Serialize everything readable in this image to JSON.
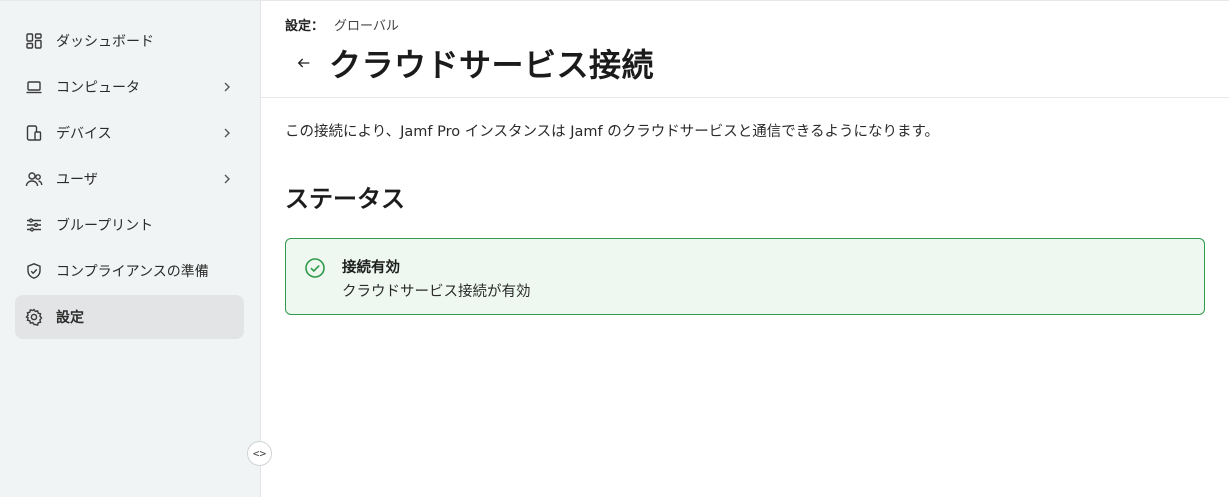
{
  "sidebar": {
    "items": [
      {
        "label": "ダッシュボード",
        "icon": "dashboard-icon",
        "has_children": false
      },
      {
        "label": "コンピュータ",
        "icon": "laptop-icon",
        "has_children": true
      },
      {
        "label": "デバイス",
        "icon": "device-icon",
        "has_children": true
      },
      {
        "label": "ユーザ",
        "icon": "users-icon",
        "has_children": true
      },
      {
        "label": "ブループリント",
        "icon": "sliders-icon",
        "has_children": false
      },
      {
        "label": "コンプライアンスの準備",
        "icon": "shield-check-icon",
        "has_children": false
      },
      {
        "label": "設定",
        "icon": "gear-icon",
        "has_children": false,
        "active": true
      }
    ],
    "collapse_label": "<>"
  },
  "header": {
    "breadcrumb_root": "設定：",
    "breadcrumb_current": "グローバル",
    "title": "クラウドサービス接続"
  },
  "main": {
    "description": "この接続により、Jamf Pro インスタンスは Jamf のクラウドサービスと通信できるようになります。",
    "status_section_title": "ステータス",
    "status": {
      "title": "接続有効",
      "subtitle": "クラウドサービス接続が有効",
      "color": "#2f9a4c"
    }
  }
}
